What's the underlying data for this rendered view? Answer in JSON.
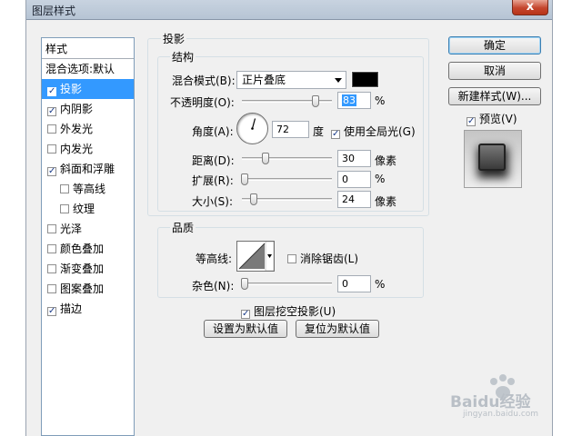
{
  "window": {
    "title": "图层样式",
    "close_symbol": "x"
  },
  "style_list": {
    "header": "样式",
    "blend_options": "混合选项:默认",
    "items": [
      {
        "label": "投影",
        "checked": true,
        "selected": true
      },
      {
        "label": "内阴影",
        "checked": true
      },
      {
        "label": "外发光",
        "checked": false
      },
      {
        "label": "内发光",
        "checked": false
      },
      {
        "label": "斜面和浮雕",
        "checked": true
      },
      {
        "label": "等高线",
        "checked": false,
        "sub": true
      },
      {
        "label": "纹理",
        "checked": false,
        "sub": true
      },
      {
        "label": "光泽",
        "checked": false
      },
      {
        "label": "颜色叠加",
        "checked": false
      },
      {
        "label": "渐变叠加",
        "checked": false
      },
      {
        "label": "图案叠加",
        "checked": false
      },
      {
        "label": "描边",
        "checked": true
      }
    ]
  },
  "drop_shadow": {
    "section_title": "投影",
    "structure_title": "结构",
    "blend_mode_label": "混合模式(B):",
    "blend_mode_value": "正片叠底",
    "shadow_color": "#000000",
    "opacity_label": "不透明度(O):",
    "opacity_value": "83",
    "opacity_unit": "%",
    "angle_label": "角度(A):",
    "angle_value": "72",
    "angle_unit": "度",
    "global_light_label": "使用全局光(G)",
    "global_light_checked": true,
    "distance_label": "距离(D):",
    "distance_value": "30",
    "distance_unit": "像素",
    "spread_label": "扩展(R):",
    "spread_value": "0",
    "spread_unit": "%",
    "size_label": "大小(S):",
    "size_value": "24",
    "size_unit": "像素"
  },
  "quality": {
    "title": "品质",
    "contour_label": "等高线:",
    "anti_alias_label": "消除锯齿(L)",
    "anti_alias_checked": false,
    "noise_label": "杂色(N):",
    "noise_value": "0",
    "noise_unit": "%"
  },
  "layer_knockout": {
    "label": "图层挖空投影(U)",
    "checked": true
  },
  "buttons": {
    "make_default": "设置为默认值",
    "reset_default": "复位为默认值",
    "ok": "确定",
    "cancel": "取消",
    "new_style": "新建样式(W)...",
    "preview_label": "预览(V)",
    "preview_checked": true
  },
  "watermark": {
    "text": "Baidu经验",
    "sub": "jingyan.baidu.com"
  }
}
